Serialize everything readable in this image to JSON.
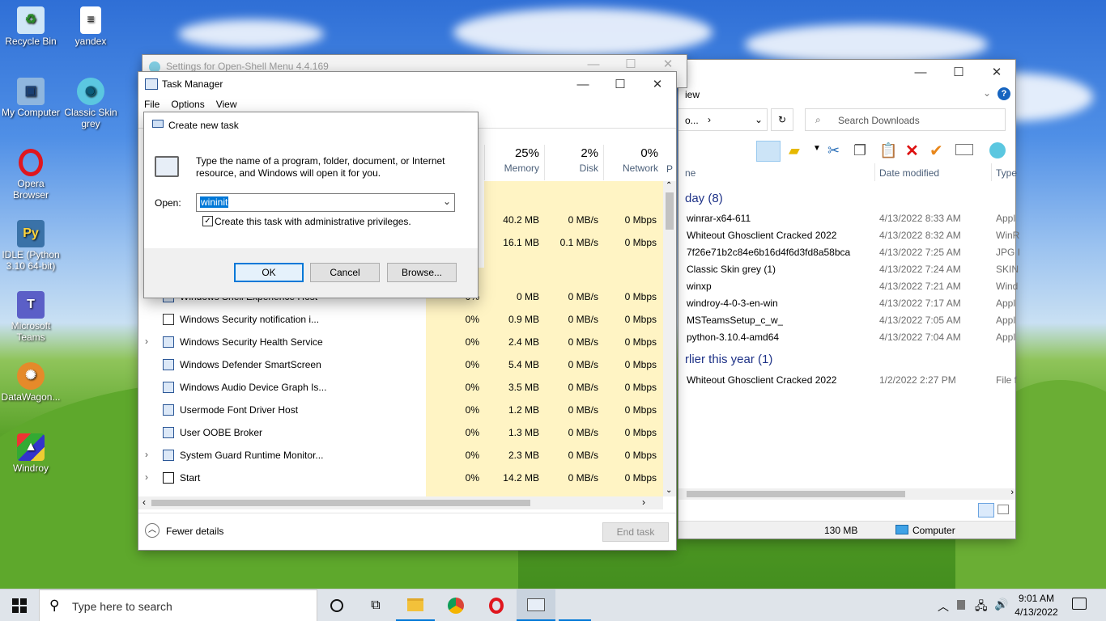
{
  "desktop": {
    "icons": [
      {
        "label": "Recycle Bin",
        "icon": "recycle-bin-icon"
      },
      {
        "label": "yandex",
        "icon": "text-file-icon"
      },
      {
        "label": "My Computer",
        "icon": "computer-icon"
      },
      {
        "label": "Classic Skin grey",
        "icon": "shell-icon"
      },
      {
        "label": "Opera Browser",
        "icon": "opera-icon"
      },
      {
        "label": "IDLE (Python 3.10 64-bit)",
        "icon": "python-icon"
      },
      {
        "label": "Microsoft Teams",
        "icon": "teams-icon"
      },
      {
        "label": "DataWagon...",
        "icon": "datawagon-icon"
      },
      {
        "label": "Windroy",
        "icon": "windroy-icon"
      }
    ]
  },
  "settings_window": {
    "title": "Settings for Open-Shell Menu 4.4.169"
  },
  "explorer": {
    "ribbon_tab_partial": "iew",
    "address_partial": "o...",
    "search_placeholder": "Search Downloads",
    "columns": {
      "name": "ne",
      "date": "Date modified",
      "type": "Type"
    },
    "groups": [
      {
        "label": "day (8)",
        "items": [
          {
            "name": "winrar-x64-611",
            "date": "4/13/2022 8:33 AM",
            "type": "Appl"
          },
          {
            "name": "Whiteout Ghosclient Cracked 2022",
            "date": "4/13/2022 8:32 AM",
            "type": "WinR"
          },
          {
            "name": "7f26e71b2c84e6b16d4f6d3fd8a58bca",
            "date": "4/13/2022 7:25 AM",
            "type": "JPG I"
          },
          {
            "name": "Classic Skin grey (1)",
            "date": "4/13/2022 7:24 AM",
            "type": "SKIN"
          },
          {
            "name": "winxp",
            "date": "4/13/2022 7:21 AM",
            "type": "Wind"
          },
          {
            "name": "windroy-4-0-3-en-win",
            "date": "4/13/2022 7:17 AM",
            "type": "Appl"
          },
          {
            "name": "MSTeamsSetup_c_w_",
            "date": "4/13/2022 7:05 AM",
            "type": "Appl"
          },
          {
            "name": "python-3.10.4-amd64",
            "date": "4/13/2022 7:04 AM",
            "type": "Appl"
          }
        ]
      },
      {
        "label": "rlier this year (1)",
        "items": [
          {
            "name": "Whiteout Ghosclient Cracked 2022",
            "date": "1/2/2022 2:27 PM",
            "type": "File f"
          }
        ]
      }
    ],
    "status_size": "130 MB",
    "status_location": "Computer"
  },
  "task_manager": {
    "title": "Task Manager",
    "menu": [
      "File",
      "Options",
      "View"
    ],
    "headers": {
      "memory_pct": "25%",
      "memory": "Memory",
      "disk_pct": "2%",
      "disk": "Disk",
      "network_pct": "0%",
      "network": "Network",
      "power_partial": "P"
    },
    "top_rows": [
      {
        "memory": "40.2 MB",
        "disk": "0 MB/s",
        "network": "0 Mbps"
      },
      {
        "memory": "16.1 MB",
        "disk": "0.1 MB/s",
        "network": "0 Mbps"
      }
    ],
    "rows": [
      {
        "name": "Windows Shell Experience Host",
        "expandable": false,
        "cpu": "0%",
        "memory": "0 MB",
        "disk": "0 MB/s",
        "network": "0 Mbps"
      },
      {
        "name": "Windows Security notification i...",
        "expandable": false,
        "cpu": "0%",
        "memory": "0.9 MB",
        "disk": "0 MB/s",
        "network": "0 Mbps"
      },
      {
        "name": "Windows Security Health Service",
        "expandable": true,
        "cpu": "0%",
        "memory": "2.4 MB",
        "disk": "0 MB/s",
        "network": "0 Mbps"
      },
      {
        "name": "Windows Defender SmartScreen",
        "expandable": false,
        "cpu": "0%",
        "memory": "5.4 MB",
        "disk": "0 MB/s",
        "network": "0 Mbps"
      },
      {
        "name": "Windows Audio Device Graph Is...",
        "expandable": false,
        "cpu": "0%",
        "memory": "3.5 MB",
        "disk": "0 MB/s",
        "network": "0 Mbps"
      },
      {
        "name": "Usermode Font Driver Host",
        "expandable": false,
        "cpu": "0%",
        "memory": "1.2 MB",
        "disk": "0 MB/s",
        "network": "0 Mbps"
      },
      {
        "name": "User OOBE Broker",
        "expandable": false,
        "cpu": "0%",
        "memory": "1.3 MB",
        "disk": "0 MB/s",
        "network": "0 Mbps"
      },
      {
        "name": "System Guard Runtime Monitor...",
        "expandable": true,
        "cpu": "0%",
        "memory": "2.3 MB",
        "disk": "0 MB/s",
        "network": "0 Mbps"
      },
      {
        "name": "Start",
        "expandable": true,
        "cpu": "0%",
        "memory": "14.2 MB",
        "disk": "0 MB/s",
        "network": "0 Mbps"
      }
    ],
    "fewer_details": "Fewer details",
    "end_task": "End task"
  },
  "run_dialog": {
    "title": "Create new task",
    "description": "Type the name of a program, folder, document, or Internet resource, and Windows will open it for you.",
    "open_label": "Open:",
    "open_value": "wininit",
    "admin_checkbox_label": "Create this task with administrative privileges.",
    "admin_checked": true,
    "ok": "OK",
    "cancel": "Cancel",
    "browse": "Browse..."
  },
  "taskbar": {
    "search_placeholder": "Type here to search",
    "time": "9:01 AM",
    "date": "4/13/2022"
  },
  "colors": {
    "accent": "#0078d7",
    "heat_yellow": "#fff4c4",
    "heat_yellow_strong": "#fde9a0",
    "taskbar": "#dfe4ea"
  }
}
